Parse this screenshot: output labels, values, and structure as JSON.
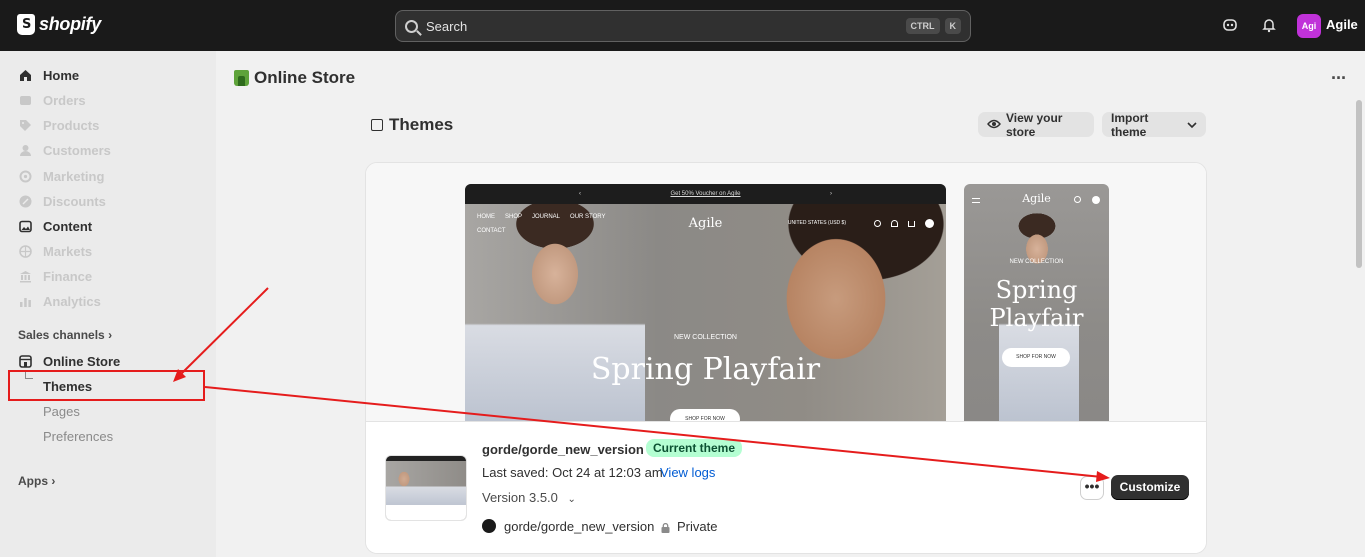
{
  "topbar": {
    "logo_text": "shopify",
    "search_placeholder": "Search",
    "shortcut_key1": "CTRL",
    "shortcut_key2": "K",
    "avatar_initials": "Agi",
    "store_name": "Agile"
  },
  "sidebar": {
    "items": [
      {
        "label": "Home",
        "icon": "home-icon",
        "active": true
      },
      {
        "label": "Orders",
        "icon": "orders-icon",
        "active": false
      },
      {
        "label": "Products",
        "icon": "tag-icon",
        "active": false
      },
      {
        "label": "Customers",
        "icon": "person-icon",
        "active": false
      },
      {
        "label": "Marketing",
        "icon": "target-icon",
        "active": false
      },
      {
        "label": "Discounts",
        "icon": "discount-icon",
        "active": false
      },
      {
        "label": "Content",
        "icon": "image-icon",
        "active": true
      },
      {
        "label": "Markets",
        "icon": "globe-icon",
        "active": false
      },
      {
        "label": "Finance",
        "icon": "bank-icon",
        "active": false
      },
      {
        "label": "Analytics",
        "icon": "bar-chart-icon",
        "active": false
      }
    ],
    "sales_channels_label": "Sales channels",
    "online_store_label": "Online Store",
    "sub_items": [
      "Themes",
      "Pages",
      "Preferences"
    ],
    "apps_label": "Apps"
  },
  "header": {
    "title": "Online Store"
  },
  "themes": {
    "title": "Themes",
    "view_store_label": "View your store",
    "import_theme_label": "Import theme"
  },
  "preview": {
    "announcement": "Get 50% Voucher on Agile",
    "brand": "Agile",
    "nav": [
      "HOME",
      "SHOP",
      "JOURNAL",
      "OUR STORY",
      "CONTACT"
    ],
    "region": "UNITED STATES (USD $)",
    "collection": "NEW COLLECTION",
    "headline": "Spring Playfair",
    "mobile_headline_1": "Spring",
    "mobile_headline_2": "Playfair",
    "shop_button": "SHOP FOR NOW"
  },
  "current_theme": {
    "name": "gorde/gorde_new_version",
    "badge": "Current theme",
    "last_saved": "Last saved: Oct 24 at 12:03 am",
    "view_logs": "View logs",
    "version": "Version 3.5.0",
    "repo": "gorde/gorde_new_version",
    "visibility": "Private",
    "more_label": "•••",
    "customize_label": "Customize"
  },
  "colors": {
    "topbar": "#1a1a1a",
    "accent_badge": "#b4fed2",
    "link": "#005bd3",
    "annotation": "#e51c1c"
  }
}
